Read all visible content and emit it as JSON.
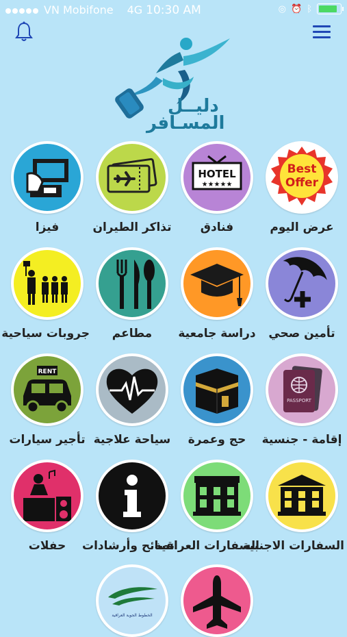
{
  "status": {
    "carrier": "VN Mobifone",
    "network": "4G",
    "time": "10:30 AM"
  },
  "header": {
    "logo_line1": "دليــل",
    "logo_line2": "المسـافر"
  },
  "tiles": [
    {
      "label": "عرض اليوم",
      "icon": "best-offer-icon",
      "color": "#e8342a"
    },
    {
      "label": "فنادق",
      "icon": "hotel-icon",
      "color": "#b884d6"
    },
    {
      "label": "تذاكر الطيران",
      "icon": "flight-ticket-icon",
      "color": "#bcd84a"
    },
    {
      "label": "فيزا",
      "icon": "visa-icon",
      "color": "#2aa6d6"
    },
    {
      "label": "تأمين صحي",
      "icon": "umbrella-icon",
      "color": "#8a86d8"
    },
    {
      "label": "دراسة جامعية",
      "icon": "graduation-cap-icon",
      "color": "#ff9826"
    },
    {
      "label": "مطاعم",
      "icon": "restaurant-icon",
      "color": "#35a090"
    },
    {
      "label": "جروبات سياحية",
      "icon": "tour-group-icon",
      "color": "#f4ee22"
    },
    {
      "label": "إقامة - جنسية",
      "icon": "passport-icon",
      "color": "#d8a8d0"
    },
    {
      "label": "حج وعمرة",
      "icon": "kaaba-icon",
      "color": "#3a93cc"
    },
    {
      "label": "سياحة علاجية",
      "icon": "heart-rate-icon",
      "color": "#aabbc6"
    },
    {
      "label": "تأجير سيارات",
      "icon": "rent-car-icon",
      "color": "#7ca33a"
    },
    {
      "label": "السفارات الاجنبية",
      "icon": "foreign-embassy-icon",
      "color": "#f8e14a"
    },
    {
      "label": "السفارات العراقية",
      "icon": "iraqi-embassy-icon",
      "color": "#7ddc78"
    },
    {
      "label": "نصائح وأرشادات",
      "icon": "info-icon",
      "color": "#111111"
    },
    {
      "label": "حفلات",
      "icon": "party-icon",
      "color": "#e0306a"
    },
    {
      "label": "",
      "icon": "airplane-icon",
      "color": "#ee5a8e"
    },
    {
      "label": "",
      "icon": "iraqi-airways-icon",
      "color": "#bfe2f7"
    }
  ],
  "iconText": {
    "best": "Best",
    "offer": "Offer",
    "hotel": "HOTEL",
    "stars": "★★★★★",
    "passport": "PASSPORT",
    "rent": "RENT",
    "airways": "الخطوط الجوية العراقية"
  }
}
